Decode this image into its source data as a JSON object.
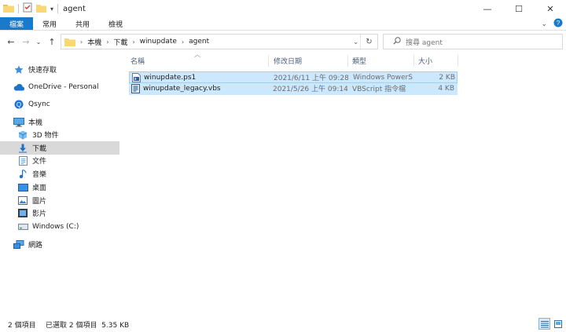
{
  "window": {
    "title": "agent",
    "controls": {
      "minimize": "—",
      "maximize": "☐",
      "close": "✕"
    }
  },
  "ribbon": {
    "tabs": [
      "檔案",
      "常用",
      "共用",
      "檢視"
    ]
  },
  "address": {
    "crumbs": [
      "本機",
      "下載",
      "winupdate",
      "agent"
    ],
    "search_placeholder": "搜尋 agent"
  },
  "sidebar": {
    "items": [
      {
        "label": "快速存取",
        "icon": "star-icon"
      },
      {
        "label": "OneDrive - Personal",
        "icon": "cloud-icon"
      },
      {
        "label": "Qsync",
        "icon": "qsync-icon"
      },
      {
        "label": "本機",
        "icon": "computer-icon"
      },
      {
        "label": "3D 物件",
        "icon": "cube-icon"
      },
      {
        "label": "下載",
        "icon": "download-icon"
      },
      {
        "label": "文件",
        "icon": "document-icon"
      },
      {
        "label": "音樂",
        "icon": "music-icon"
      },
      {
        "label": "桌面",
        "icon": "desktop-icon"
      },
      {
        "label": "圖片",
        "icon": "pictures-icon"
      },
      {
        "label": "影片",
        "icon": "videos-icon"
      },
      {
        "label": "Windows (C:)",
        "icon": "drive-icon"
      },
      {
        "label": "網路",
        "icon": "network-icon"
      }
    ]
  },
  "columns": {
    "name": "名稱",
    "date": "修改日期",
    "type": "類型",
    "size": "大小"
  },
  "files": [
    {
      "name": "winupdate.ps1",
      "date": "2021/6/11 上午 09:28",
      "type": "Windows PowerS...",
      "size": "2 KB",
      "icon": "powershell-file-icon"
    },
    {
      "name": "winupdate_legacy.vbs",
      "date": "2021/5/26 上午 09:14",
      "type": "VBScript 指令檔",
      "size": "4 KB",
      "icon": "vbscript-file-icon"
    }
  ],
  "status": {
    "item_count": "2 個項目",
    "selected": "已選取 2 個項目  5.35 KB"
  },
  "colors": {
    "accent": "#1979ca",
    "selection": "#cce8ff",
    "selection_border": "#99d1ff",
    "folder": "#f8d775"
  }
}
